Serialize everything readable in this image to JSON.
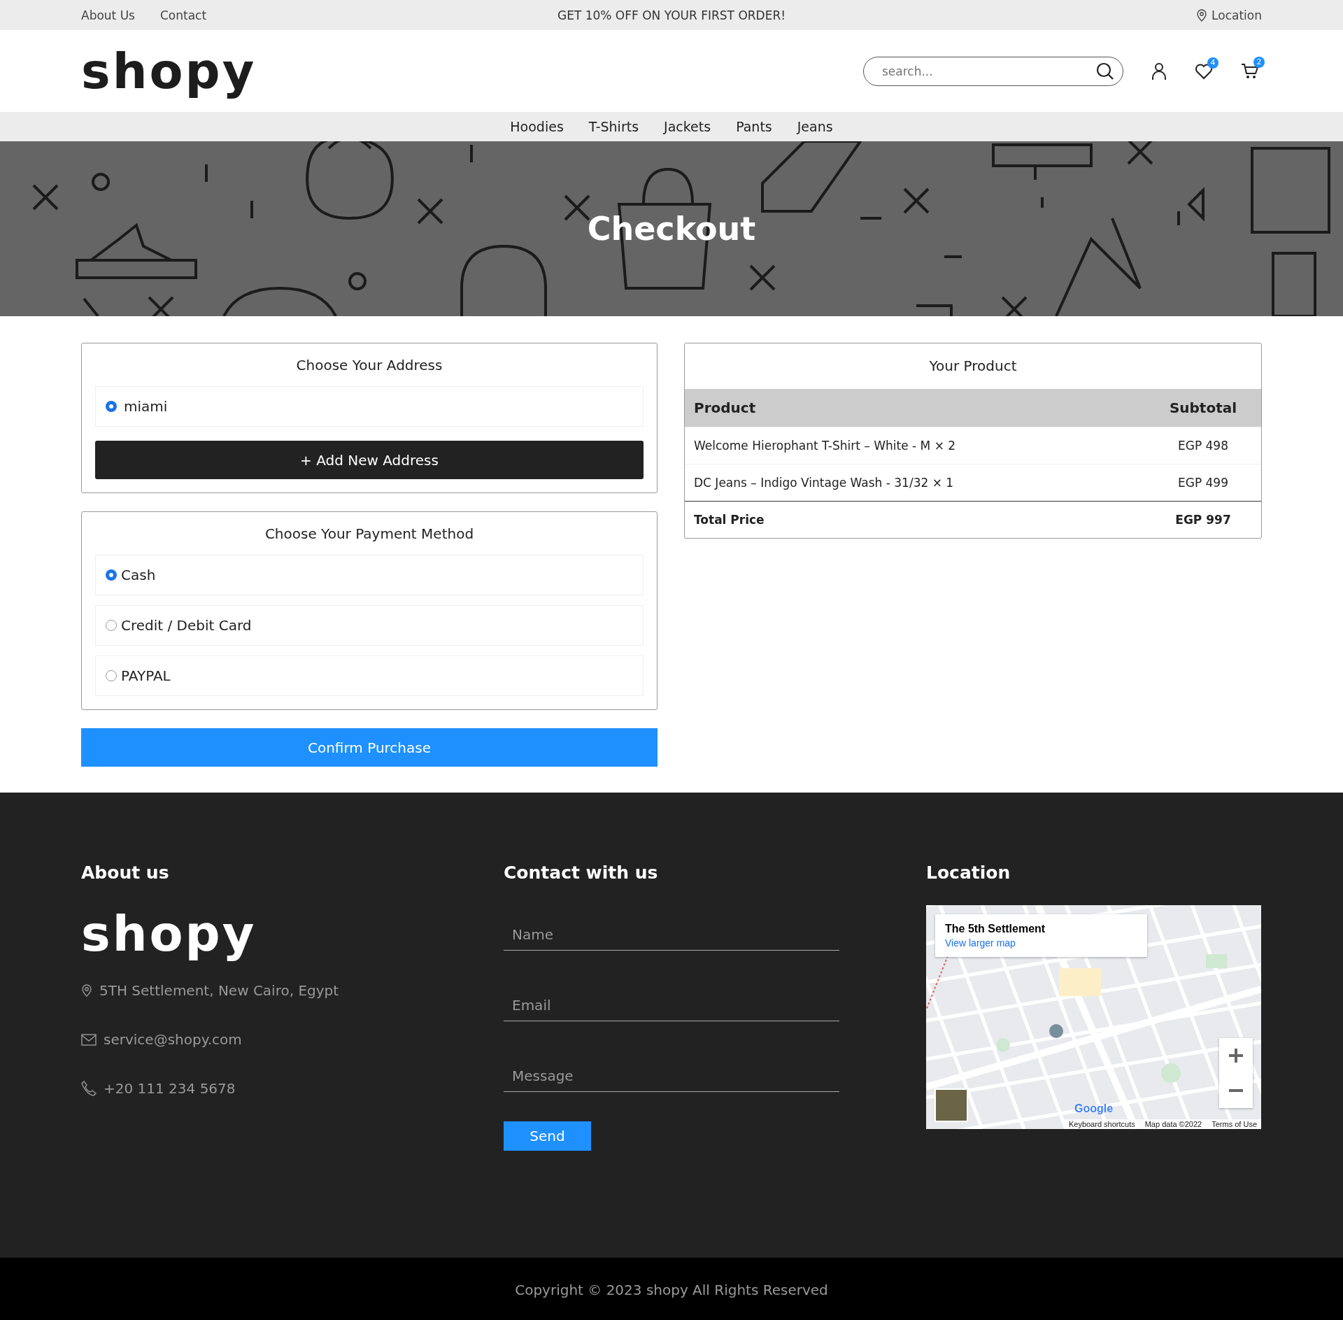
{
  "top_bar": {
    "links": [
      "About Us",
      "Contact"
    ],
    "promo": "GET 10% OFF ON YOUR FIRST ORDER!",
    "location": "Location"
  },
  "header": {
    "logo": "shopy",
    "search": {
      "placeholder": "search..."
    },
    "wishlist_count": "4",
    "cart_count": "2"
  },
  "nav": [
    "Hoodies",
    "T-Shirts",
    "Jackets",
    "Pants",
    "Jeans"
  ],
  "banner": {
    "title": "Checkout"
  },
  "address_section": {
    "title": "Choose Your Address",
    "addresses": [
      {
        "label": "miami",
        "selected": true
      }
    ],
    "add_button": "+ Add New Address"
  },
  "payment_section": {
    "title": "Choose Your Payment Method",
    "methods": [
      {
        "label": "Cash",
        "selected": true
      },
      {
        "label": "Credit / Debit Card",
        "selected": false
      },
      {
        "label": "PAYPAL",
        "selected": false
      }
    ]
  },
  "confirm_button": "Confirm Purchase",
  "order_summary": {
    "title": "Your Product",
    "columns": [
      "Product",
      "Subtotal"
    ],
    "rows": [
      {
        "product": "Welcome Hierophant T-Shirt – White - M × 2",
        "subtotal": "EGP 498"
      },
      {
        "product": "DC Jeans – Indigo Vintage Wash - 31/32 × 1",
        "subtotal": "EGP 499"
      }
    ],
    "total": {
      "label": "Total Price",
      "value": "EGP 997"
    }
  },
  "footer": {
    "about": {
      "heading": "About us",
      "logo": "shopy",
      "address": "5TH Settlement, New Cairo, Egypt",
      "email": "service@shopy.com",
      "phone": "+20 111 234 5678"
    },
    "contact": {
      "heading": "Contact with us",
      "fields": [
        {
          "placeholder": "Name"
        },
        {
          "placeholder": "Email"
        },
        {
          "placeholder": "Message"
        }
      ],
      "send_button": "Send"
    },
    "location": {
      "heading": "Location",
      "map": {
        "place_title": "The 5th Settlement",
        "link": "View larger map",
        "logo": "Google",
        "attributions": [
          "Keyboard shortcuts",
          "Map data ©2022",
          "Terms of Use"
        ]
      }
    }
  },
  "copyright": "Copyright © 2023 shopy All Rights Reserved"
}
